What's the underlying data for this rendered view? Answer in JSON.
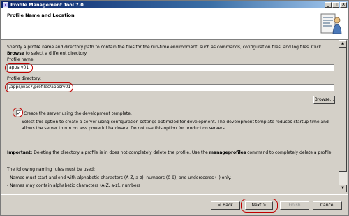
{
  "window": {
    "title": "Profile Management Tool 7.0",
    "minimize_glyph": "_",
    "maximize_glyph": "□",
    "close_glyph": "×"
  },
  "header": {
    "page_title": "Profile Name and Location"
  },
  "content": {
    "description_part1": "Specify a profile name and directory path to contain the files for the run-time environment, such as commands, configuration files, and log files. Click ",
    "description_bold": "Browse",
    "description_part2": " to select a different directory.",
    "profile_name_label": "Profile name:",
    "profile_name_value": "appsrv01",
    "profile_directory_label": "Profile directory:",
    "profile_directory_value": "/apps/was7/profiles/appsrv01",
    "browse_label": "Browse...",
    "dev_template_checked": true,
    "dev_template_label": "Create the server using the development template.",
    "dev_template_desc": "Select this option to create a server using configuration settings optimized for development. The development template reduces startup time and allows the server to run on less powerful hardware. Do not use this option for production servers.",
    "important_label": "Important:",
    "important_part1": " Deleting the directory a profile is in does not completely delete the profile. Use the ",
    "important_bold": "manageprofiles",
    "important_part2": " command to completely delete a profile.",
    "naming_rules_intro": "The following naming rules must be used:",
    "rule_1": "- Names must start and end with alphabetic characters (A-Z, a-z), numbers (0-9), and underscores (_) only.",
    "rule_2": "- Names may contain alphabetic characters (A-Z, a-z), numbers"
  },
  "footer": {
    "back_label": "< Back",
    "next_label": "Next >",
    "finish_label": "Finish",
    "cancel_label": "Cancel"
  },
  "colors": {
    "annotation": "#c00000",
    "titlebar": "#0a246a"
  }
}
